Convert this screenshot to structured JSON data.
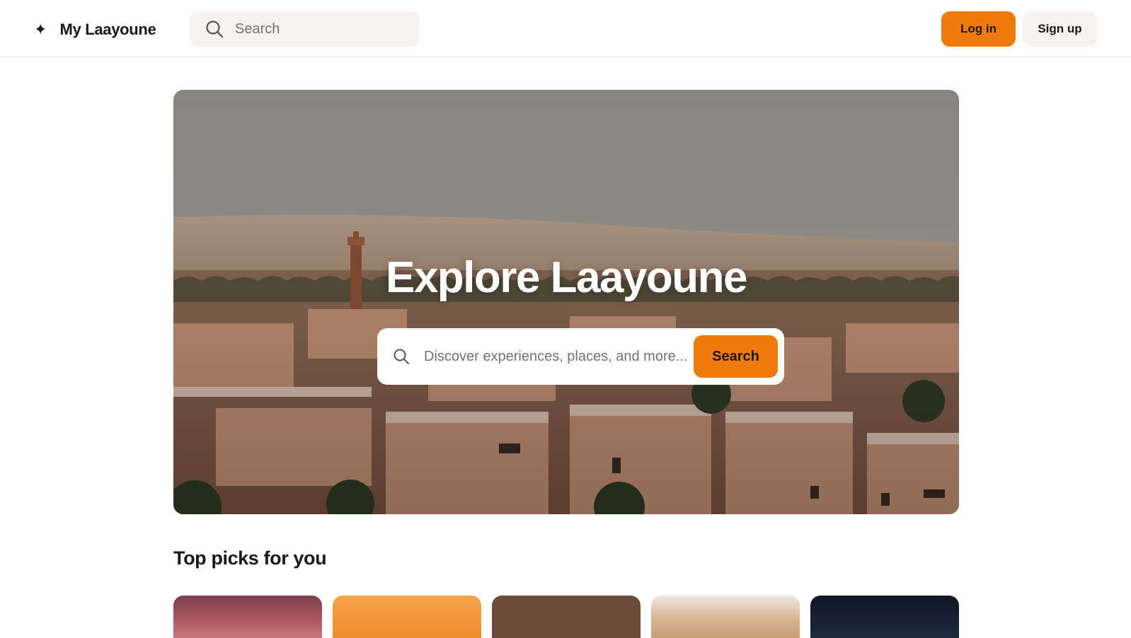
{
  "header": {
    "logo_mark": "✦",
    "site_name": "My Laayoune",
    "search_placeholder": "Search",
    "login_label": "Log in",
    "signup_label": "Sign up"
  },
  "hero": {
    "title": "Explore Laayoune",
    "search_placeholder": "Discover experiences, places, and more...",
    "search_button_label": "Search",
    "image_description_icon": "desert-town-photo"
  },
  "top_picks": {
    "title": "Top picks for you",
    "cards": [
      {
        "name": "pick-card-1",
        "tone": "#b05a62"
      },
      {
        "name": "pick-card-2",
        "tone": "#f08a2e"
      },
      {
        "name": "pick-card-3",
        "tone": "#6b4b3a"
      },
      {
        "name": "pick-card-4",
        "tone": "#d7b494"
      },
      {
        "name": "pick-card-5",
        "tone": "#1d2a3d"
      }
    ]
  },
  "colors": {
    "accent": "#f07a0c",
    "surface_muted": "#f5f2ef",
    "text": "#1c1917",
    "placeholder": "#78716c"
  },
  "icons": {
    "logo": "sparkle-icon",
    "search": "search-icon"
  }
}
